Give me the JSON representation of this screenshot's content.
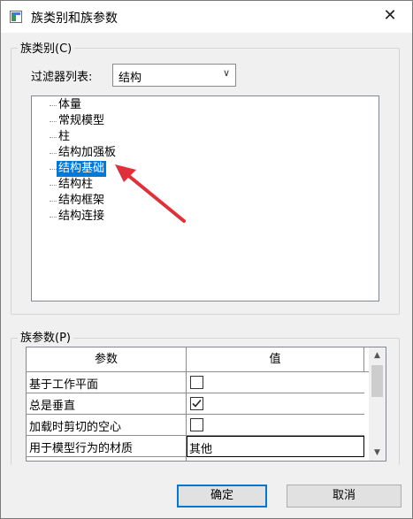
{
  "window": {
    "title": "族类别和族参数"
  },
  "category_group": {
    "legend": "族类别(C)",
    "filter_label": "过滤器列表:",
    "filter_value": "结构",
    "items": [
      {
        "label": "体量"
      },
      {
        "label": "常规模型"
      },
      {
        "label": "柱"
      },
      {
        "label": "结构加强板"
      },
      {
        "label": "结构基础"
      },
      {
        "label": "结构柱"
      },
      {
        "label": "结构框架"
      },
      {
        "label": "结构连接"
      }
    ],
    "selected_index": 4
  },
  "params_group": {
    "legend": "族参数(P)",
    "col_param": "参数",
    "col_value": "值",
    "rows": [
      {
        "name": "基于工作平面",
        "type": "checkbox",
        "checked": false
      },
      {
        "name": "总是垂直",
        "type": "checkbox",
        "checked": true
      },
      {
        "name": "加载时剪切的空心",
        "type": "checkbox",
        "checked": false
      },
      {
        "name": "用于模型行为的材质",
        "type": "text",
        "value": "其他"
      }
    ]
  },
  "buttons": {
    "ok": "确定",
    "cancel": "取消"
  },
  "colors": {
    "selection": "#0078d7",
    "arrow": "#e0303a"
  }
}
